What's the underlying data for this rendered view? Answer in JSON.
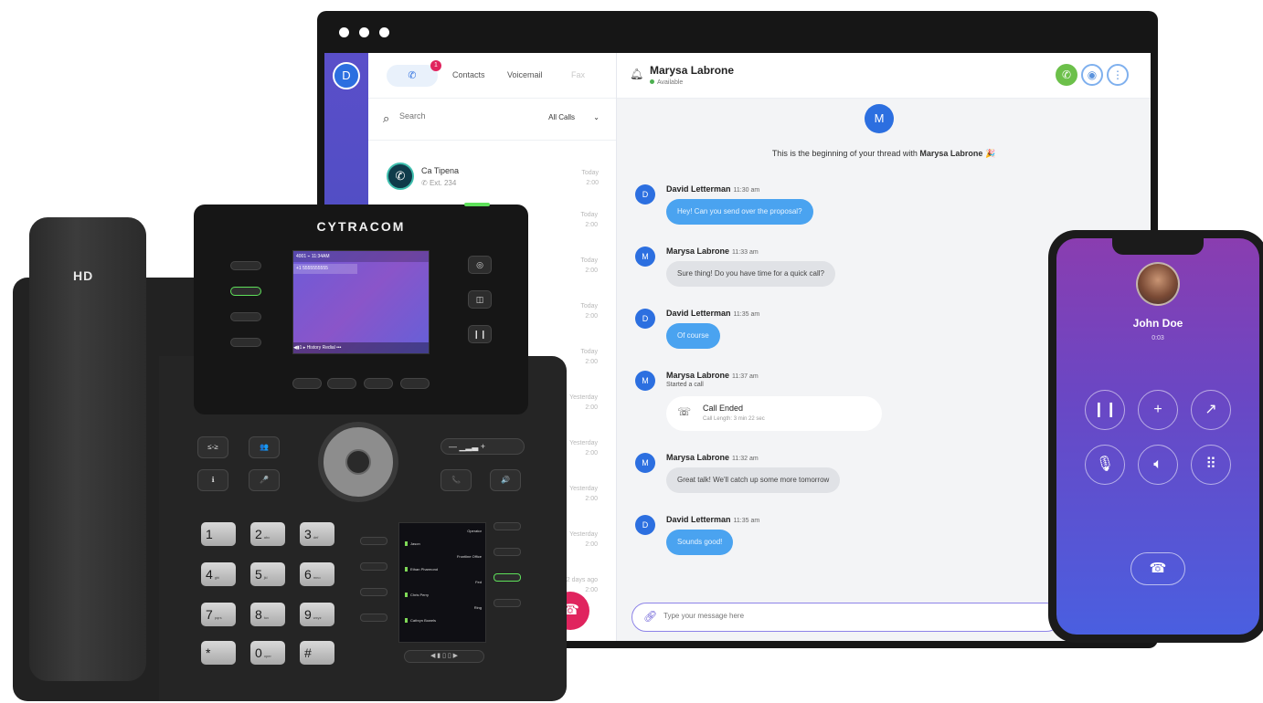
{
  "app": {
    "rail": {
      "avatar_initial": "D"
    },
    "tabs": {
      "calls_badge": "1",
      "calls_icon": "phone-icon",
      "contacts": "Contacts",
      "voicemail": "Voicemail",
      "fax": "Fax"
    },
    "search": {
      "placeholder": "Search",
      "filter": "All Calls",
      "filter_caret": "⌄"
    },
    "contacts": [
      {
        "name": "Ca Tipena",
        "ext": "Ext. 234",
        "time": [
          "Today",
          "2:00"
        ]
      }
    ],
    "call_times": [
      [
        "Today",
        "2:00"
      ],
      [
        "Today",
        "2:00"
      ],
      [
        "Today",
        "2:00"
      ],
      [
        "Today",
        "2:00"
      ],
      [
        "Yesterday",
        "2:00"
      ],
      [
        "Yesterday",
        "2:00"
      ],
      [
        "Yesterday",
        "2:00"
      ],
      [
        "Yesterday",
        "2:00"
      ],
      [
        "2 days ago",
        "2:00"
      ]
    ],
    "chat": {
      "name": "Marysa Labrone",
      "status": "Available",
      "status_color": "#4caf50",
      "intro_avatar": "M",
      "intro_text": "This is the beginning of your thread with ",
      "intro_name": "Marysa Labrone",
      "messages": [
        {
          "initial": "D",
          "sender": "David Letterman",
          "time": "11:30 am",
          "text": "Hey! Can you send over the proposal?"
        },
        {
          "initial": "M",
          "sender": "Marysa Labrone",
          "time": "11:33 am",
          "text": "Sure thing! Do you have time for a quick call?"
        },
        {
          "initial": "D",
          "sender": "David Letterman",
          "time": "11:35 am",
          "text": "Of course"
        },
        {
          "initial": "M",
          "sender": "Marysa Labrone",
          "time": "11:37 am",
          "sub": "Started a call",
          "card_title": "Call Ended",
          "card_len": "Call Length: 3 min 22 sec"
        },
        {
          "initial": "M",
          "sender": "Marysa Labrone",
          "time": "11:32 am",
          "text": "Great talk! We'll catch up some more tomorrow"
        },
        {
          "initial": "D",
          "sender": "David Letterman",
          "time": "11:35 am",
          "text": "Sounds good!"
        }
      ],
      "composer_placeholder": "Type your message here"
    },
    "accent": "#2c6fe0"
  },
  "mobile": {
    "caller": "John Doe",
    "timer": "0:03",
    "controls": [
      "pause-icon",
      "add-call-icon",
      "transfer-icon",
      "mute-icon",
      "speaker-icon",
      "keypad-icon"
    ],
    "end_icon": "hangup-icon"
  },
  "desk_phone": {
    "brand": "CYTRACOM",
    "handset_label": "HD",
    "lcd_status": "4001  ⌁  11:34AM",
    "lcd_number": "+1 5555555555",
    "lcd_bar": "◀▮1  ▸  History  Redial  •••",
    "keys": [
      {
        "main": "1",
        "sub": ""
      },
      {
        "main": "2",
        "sub": "abc"
      },
      {
        "main": "3",
        "sub": "def"
      },
      {
        "main": "4",
        "sub": "ghi"
      },
      {
        "main": "5",
        "sub": "jkl"
      },
      {
        "main": "6",
        "sub": "mno"
      },
      {
        "main": "7",
        "sub": "pqrs"
      },
      {
        "main": "8",
        "sub": "tuv"
      },
      {
        "main": "9",
        "sub": "wxyz"
      },
      {
        "main": "*",
        "sub": ""
      },
      {
        "main": "0",
        "sub": "oper"
      },
      {
        "main": "#",
        "sub": ""
      }
    ],
    "function_keys": [
      "≤-≥",
      "👥",
      "ℹ",
      "🎤",
      "📞",
      "🔊"
    ],
    "volume": "—  ▁▂▃  +",
    "side_screen": [
      "Operator",
      "Jason",
      "Frontline Office",
      "Ethan Pharmond",
      "Fed",
      "Chris Perry",
      "Ring",
      "Cathryn Bowels"
    ],
    "side_nav": "◀  ▮ ▯ ▯  ▶"
  }
}
